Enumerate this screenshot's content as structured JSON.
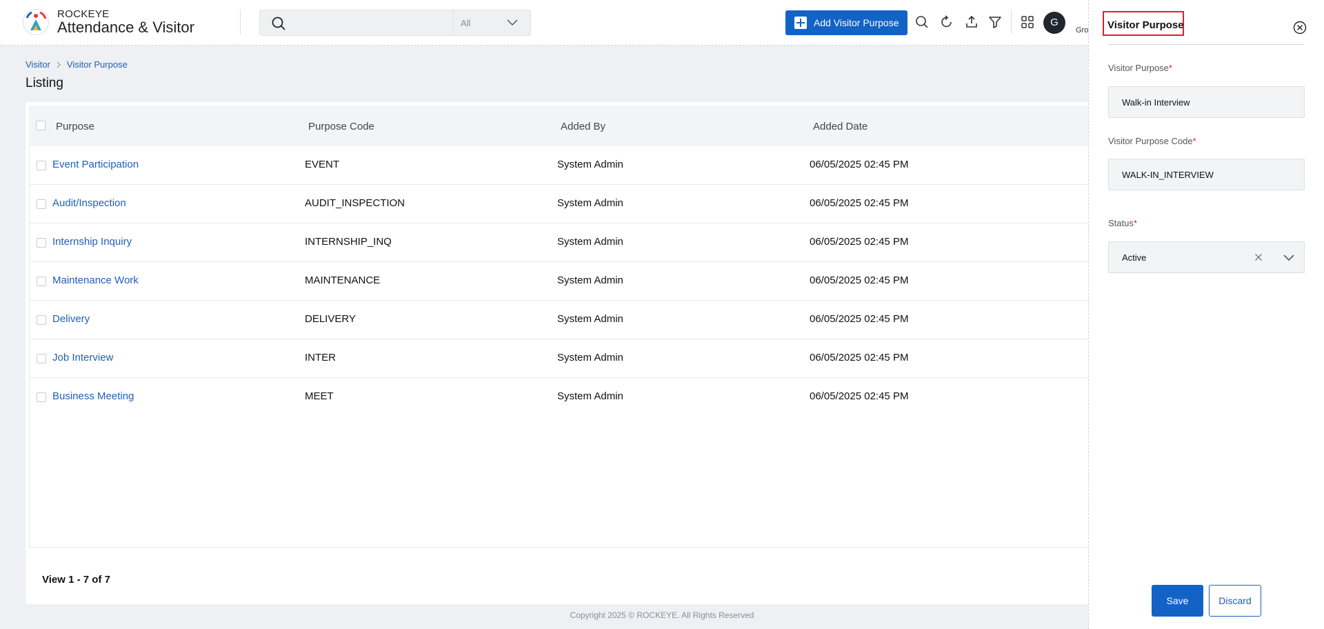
{
  "header": {
    "brand_top": "ROCKEYE",
    "brand_main": "Attendance & Visitor",
    "search": {
      "value": "",
      "placeholder": "",
      "filter_value": "All"
    },
    "add_button_label": "Add Visitor Purpose",
    "user": {
      "avatar_letter": "G",
      "name": "Gro"
    }
  },
  "breadcrumb": {
    "items": [
      "Visitor",
      "Visitor Purpose"
    ]
  },
  "page_title": "Listing",
  "table": {
    "columns": [
      "Purpose",
      "Purpose Code",
      "Added By",
      "Added Date"
    ],
    "rows": [
      {
        "purpose": "Event Participation",
        "code": "EVENT",
        "added_by": "System Admin",
        "added_date": "06/05/2025 02:45 PM"
      },
      {
        "purpose": "Audit/Inspection",
        "code": "AUDIT_INSPECTION",
        "added_by": "System Admin",
        "added_date": "06/05/2025 02:45 PM"
      },
      {
        "purpose": "Internship Inquiry",
        "code": "INTERNSHIP_INQ",
        "added_by": "System Admin",
        "added_date": "06/05/2025 02:45 PM"
      },
      {
        "purpose": "Maintenance Work",
        "code": "MAINTENANCE",
        "added_by": "System Admin",
        "added_date": "06/05/2025 02:45 PM"
      },
      {
        "purpose": "Delivery",
        "code": "DELIVERY",
        "added_by": "System Admin",
        "added_date": "06/05/2025 02:45 PM"
      },
      {
        "purpose": "Job Interview",
        "code": "INTER",
        "added_by": "System Admin",
        "added_date": "06/05/2025 02:45 PM"
      },
      {
        "purpose": "Business Meeting",
        "code": "MEET",
        "added_by": "System Admin",
        "added_date": "06/05/2025 02:45 PM"
      }
    ],
    "pager_text": "View 1 - 7 of 7"
  },
  "footer": {
    "copyright": "Copyright 2025 © ROCKEYE. All Rights Reserved"
  },
  "panel": {
    "title": "Visitor Purpose",
    "fields": {
      "purpose": {
        "label": "Visitor Purpose",
        "required_mark": "*",
        "value": "Walk-in Interview"
      },
      "code": {
        "label": "Visitor Purpose Code",
        "required_mark": "*",
        "value": "WALK-IN_INTERVIEW"
      },
      "status": {
        "label": "Status",
        "required_mark": "*",
        "value": "Active"
      }
    },
    "save_label": "Save",
    "discard_label": "Discard"
  },
  "colors": {
    "primary": "#1363c6",
    "link": "#1f5fb5",
    "required": "#e02020",
    "highlight_border": "#e02020"
  },
  "icons": [
    "app-logo-icon",
    "search-icon",
    "chevron-down-icon",
    "plus-icon",
    "refresh-icon",
    "upload-icon",
    "filter-icon",
    "grid-icon",
    "chevron-right-icon",
    "close-circle-icon",
    "clear-icon"
  ]
}
